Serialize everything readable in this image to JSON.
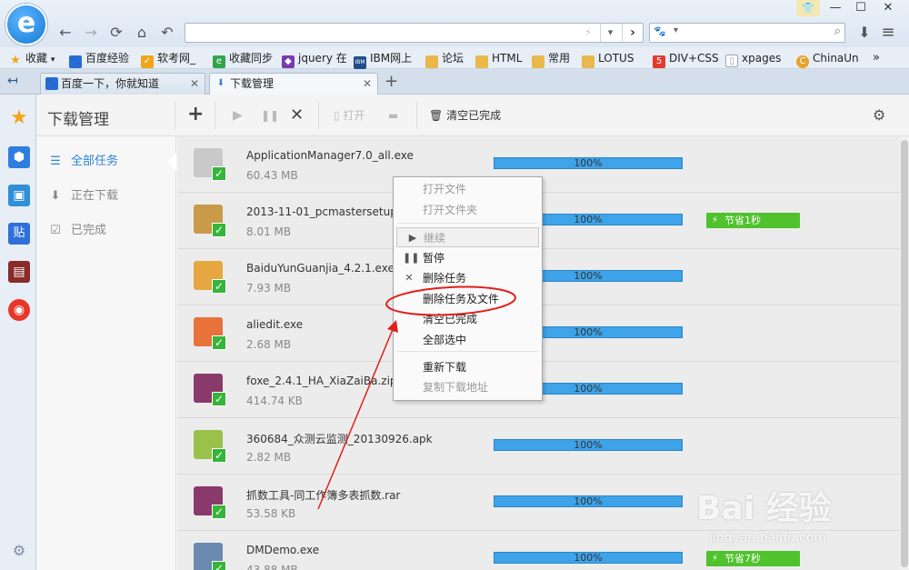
{
  "browser": {
    "logo_letter": "e",
    "nav": {
      "back": "←",
      "forward": "→",
      "refresh": "⟳",
      "home": "⌂",
      "undo": "↶"
    },
    "address": {
      "value": "",
      "lightning": "⚡",
      "dropdown": "▾",
      "go": "›"
    },
    "search": {
      "engine_icon": "🐾",
      "value": ""
    },
    "window": {
      "skin": "👕",
      "minimize": "—",
      "maximize": "☐",
      "close": "✕",
      "download": "⬇",
      "menu": "≡"
    }
  },
  "bookmarks": [
    {
      "label": "收藏",
      "icon": "★",
      "color": "#f0a51c",
      "caret": "▾"
    },
    {
      "label": "百度经验",
      "icon": "🐾",
      "color": "#2a6bd6"
    },
    {
      "label": "软考网_",
      "icon": "✓",
      "color": "#f0a51c"
    },
    {
      "label": "收藏同步",
      "icon": "e",
      "color": "#30a64a"
    },
    {
      "label": "jquery 在",
      "icon": "◆",
      "color": "#7a3ab0"
    },
    {
      "label": "IBM网上",
      "icon": "IBM",
      "color": "#1f4e8c"
    },
    {
      "label": "论坛",
      "icon": "▬",
      "color": "#e8b84a"
    },
    {
      "label": "HTML",
      "icon": "▬",
      "color": "#e8b84a"
    },
    {
      "label": "常用",
      "icon": "▬",
      "color": "#e8b84a"
    },
    {
      "label": "LOTUS",
      "icon": "▬",
      "color": "#e8b84a"
    },
    {
      "label": "DIV+CSS",
      "icon": "5",
      "color": "#e43b2c"
    },
    {
      "label": "xpages",
      "icon": "▯",
      "color": "#9aa7b3"
    },
    {
      "label": "ChinaUn",
      "icon": "C",
      "color": "#e7a12a"
    }
  ],
  "bookmarks_more": "»",
  "tabs": {
    "side_toggle": "↤",
    "items": [
      {
        "label": "百度一下，你就知道",
        "icon": "🐾",
        "close": "✕",
        "active": false
      },
      {
        "label": "下载管理",
        "icon": "⬇",
        "close": "✕",
        "active": true
      }
    ],
    "new_tab": "+"
  },
  "left_sidebar": {
    "icons": [
      {
        "name": "favorites",
        "glyph": "★",
        "color": "#f3a51b"
      },
      {
        "name": "app",
        "glyph": "⬢",
        "color": "#2f7de1"
      },
      {
        "name": "image",
        "glyph": "▣",
        "color": "#2f8fd8"
      },
      {
        "name": "tieba",
        "glyph": "贴",
        "color": "#2f6fd8"
      },
      {
        "name": "reader",
        "glyph": "▤",
        "color": "#8a2b2b"
      },
      {
        "name": "weibo",
        "glyph": "◉",
        "color": "#e8372a"
      }
    ],
    "settings": "⚙"
  },
  "download_manager": {
    "title": "下载管理",
    "toolbar": {
      "add": "+",
      "start": "▶",
      "pause": "❚❚",
      "delete": "✕",
      "open_icon": "▯",
      "open_label": "打开",
      "folder_icon": "▬",
      "clear_icon": "🗑",
      "clear_label": "清空已完成",
      "settings": "⚙"
    },
    "nav": [
      {
        "label": "全部任务",
        "icon": "☰",
        "active": true
      },
      {
        "label": "正在下载",
        "icon": "⬇",
        "active": false
      },
      {
        "label": "已完成",
        "icon": "☑",
        "active": false
      }
    ],
    "files": [
      {
        "name": "ApplicationManager7.0_all.exe",
        "size": "60.43 MB",
        "progress": "100%",
        "saved": "",
        "icon_color": "#c9c9c9"
      },
      {
        "name": "2013-11-01_pcmastersetup_5.",
        "size": "8.01 MB",
        "progress": "100%",
        "saved": "节省1秒",
        "icon_color": "#c89a4a"
      },
      {
        "name": "BaiduYunGuanjia_4.2.1.exe",
        "size": "7.93 MB",
        "progress": "100%",
        "saved": "",
        "icon_color": "#e6a640"
      },
      {
        "name": "aliedit.exe",
        "size": "2.68 MB",
        "progress": "100%",
        "saved": "",
        "icon_color": "#e8733a"
      },
      {
        "name": "foxe_2.4.1_HA_XiaZaiBa.zip",
        "size": "414.74 KB",
        "progress": "100%",
        "saved": "",
        "icon_color": "#8a3a6a"
      },
      {
        "name": "360684_众测云监测_20130926.apk",
        "size": "2.82 MB",
        "progress": "100%",
        "saved": "",
        "icon_color": "#9ac24a"
      },
      {
        "name": "抓数工具-同工作簿多表抓数.rar",
        "size": "53.58 KB",
        "progress": "100%",
        "saved": "",
        "icon_color": "#8a3a6a"
      },
      {
        "name": "DMDemo.exe",
        "size": "43.88 MB",
        "progress": "100%",
        "saved": "节省7秒",
        "icon_color": "#6a8ab0"
      }
    ]
  },
  "context_menu": {
    "items": [
      {
        "label": "打开文件",
        "icon": "",
        "disabled": true
      },
      {
        "label": "打开文件夹",
        "icon": "",
        "disabled": true
      },
      {
        "label": "继续",
        "icon": "▶",
        "disabled": true,
        "highlight": true
      },
      {
        "label": "暂停",
        "icon": "❚❚",
        "disabled": false
      },
      {
        "label": "删除任务",
        "icon": "✕",
        "disabled": false
      },
      {
        "label": "删除任务及文件",
        "icon": "",
        "disabled": false
      },
      {
        "label": "清空已完成",
        "icon": "",
        "disabled": false
      },
      {
        "label": "全部选中",
        "icon": "",
        "disabled": false
      },
      {
        "label": "重新下载",
        "icon": "",
        "disabled": false
      },
      {
        "label": "复制下载地址",
        "icon": "",
        "disabled": true
      }
    ]
  },
  "annotation": {
    "color": "#e0201b"
  },
  "watermark": {
    "brand": "Bai 经验",
    "url": "jingyan.baidu.com"
  }
}
